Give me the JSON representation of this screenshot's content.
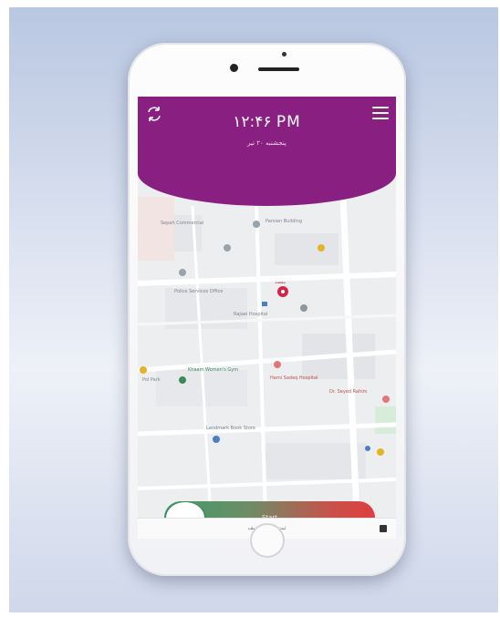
{
  "header": {
    "time": "۱۲:۴۶ PM",
    "date": "پنجشنبه ۲۰ تیر"
  },
  "map": {
    "places": [
      "Sepah Commercial",
      "Parsian Building",
      "Police Services Office",
      "Rajaei Hospital",
      "Khaam Women's Gym",
      "Hami Sadeq Hospital",
      "Dr. Seyed Rahim",
      "Landmark Book Store",
      "Pol Park"
    ],
    "marker_label": "مقصد"
  },
  "slider": {
    "label": "Start"
  },
  "bottom_bar": {
    "text": "ثبت عالی تخفیف"
  },
  "colors": {
    "header": "#8a1f82",
    "slider_start": "#3f9a6a",
    "slider_end": "#de3f3f"
  }
}
